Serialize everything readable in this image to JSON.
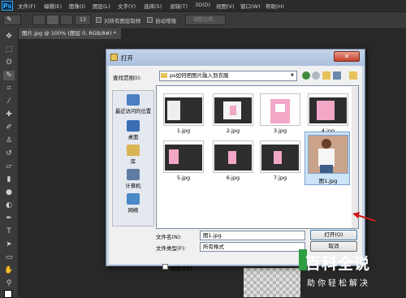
{
  "app": {
    "logo": "Ps",
    "menu": [
      "文件(F)",
      "编辑(E)",
      "图像(I)",
      "图层(L)",
      "文字(Y)",
      "选择(S)",
      "滤镜(T)",
      "3D(D)",
      "视图(V)",
      "窗口(W)",
      "帮助(H)"
    ]
  },
  "options_bar": {
    "size_value": "13",
    "sample_all_layers_label": "对所有图层取样",
    "auto_enhance_label": "自动增强",
    "refine_edge_label": "调整边缘..."
  },
  "document_tab": {
    "label": "图片.jpg @ 100% (图层 0, RGB/8#) *"
  },
  "dialog": {
    "title": "打开",
    "close_glyph": "✕",
    "look_in_label": "查找范围(I):",
    "look_in_value": "ps如何把图片融入到衣服",
    "places": [
      {
        "label": "最近访问的位置",
        "icon": "recent-places-icon",
        "color": "#4a7fc1"
      },
      {
        "label": "桌面",
        "icon": "desktop-icon",
        "color": "#3a6fb5"
      },
      {
        "label": "库",
        "icon": "libraries-icon",
        "color": "#d9b452"
      },
      {
        "label": "计算机",
        "icon": "computer-icon",
        "color": "#5f7da3"
      },
      {
        "label": "网络",
        "icon": "network-icon",
        "color": "#4a88c9"
      }
    ],
    "files": [
      {
        "name": "1.jpg",
        "selected": false
      },
      {
        "name": "2.jpg",
        "selected": false
      },
      {
        "name": "3.jpg",
        "selected": false
      },
      {
        "name": "4.jpg",
        "selected": false
      },
      {
        "name": "5.jpg",
        "selected": false
      },
      {
        "name": "6.jpg",
        "selected": false
      },
      {
        "name": "7.jpg",
        "selected": false
      },
      {
        "name": "图1.jpg",
        "selected": true
      }
    ],
    "filename_label": "文件名(N):",
    "filename_value": "图1.jpg",
    "filetype_label": "文件类型(F):",
    "filetype_value": "所有格式",
    "open_button": "打开(O)",
    "cancel_button": "取消",
    "image_sequence_label": "图像序列"
  },
  "watermark": {
    "logo": "百科全说",
    "sub": "助你轻松解决"
  },
  "colors": {
    "accent_arrow": "#d11a1a",
    "ps_blue": "#31a8ff"
  }
}
